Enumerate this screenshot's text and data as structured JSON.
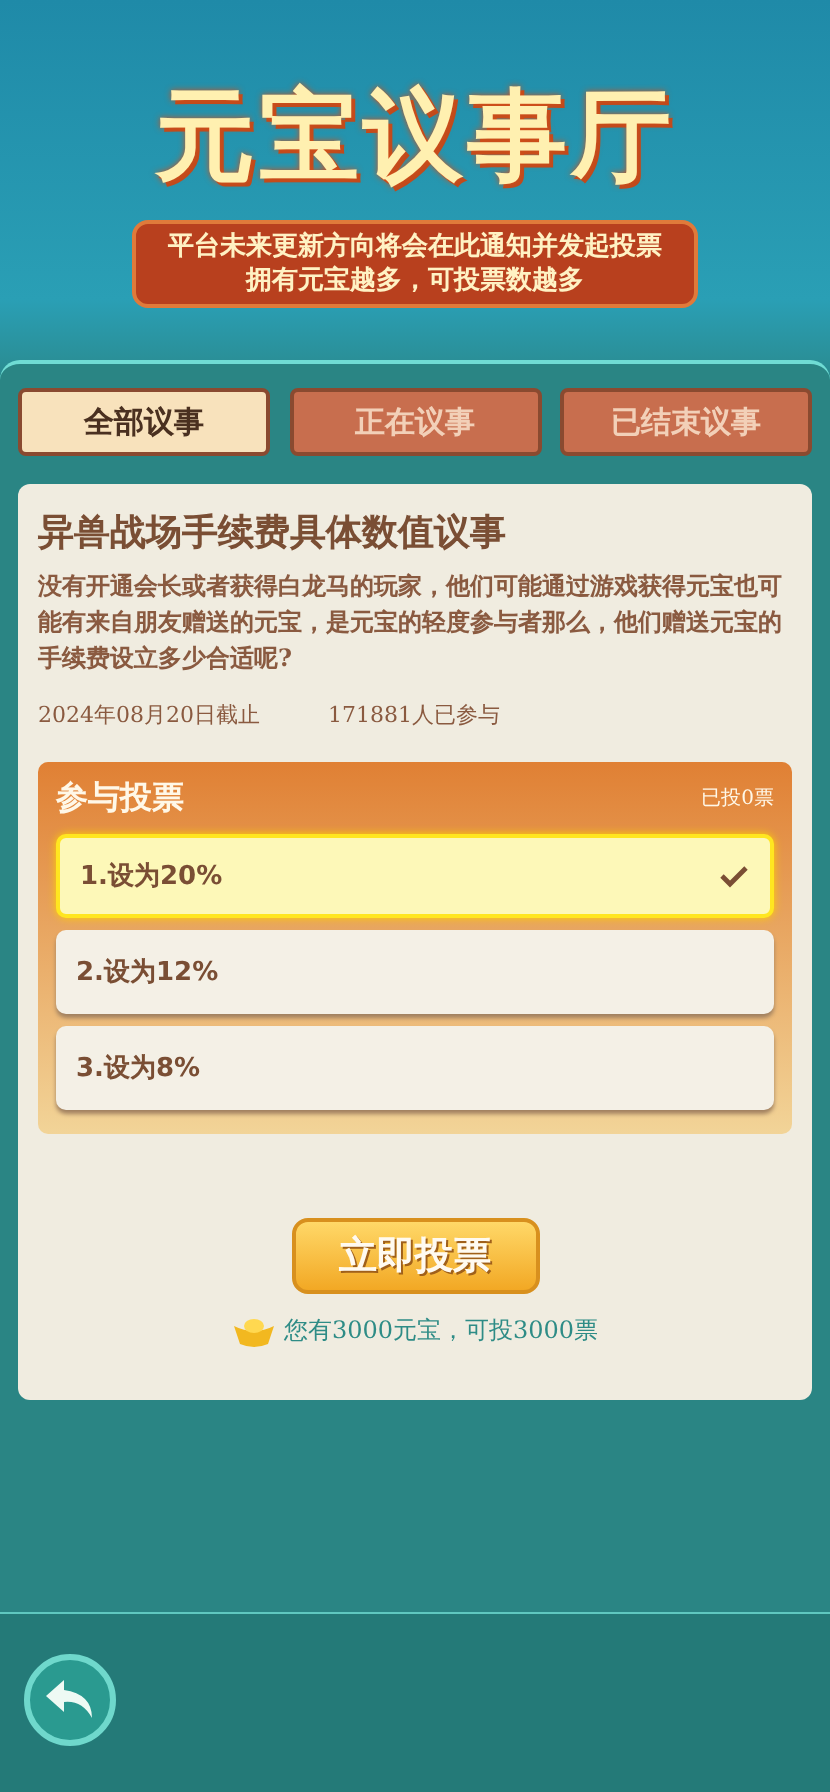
{
  "header": {
    "title": "元宝议事厅",
    "notice": [
      "平台未来更新方向将会在此通知并发起投票",
      "拥有元宝越多，可投票数越多"
    ]
  },
  "tabs": [
    {
      "label": "全部议事",
      "selected": true
    },
    {
      "label": "正在议事",
      "selected": false
    },
    {
      "label": "已结束议事",
      "selected": false
    }
  ],
  "proposal": {
    "title": "异兽战场手续费具体数值议事",
    "description": "没有开通会长或者获得白龙马的玩家，他们可能通过游戏获得元宝也可能有来自朋友赠送的元宝，是元宝的轻度参与者那么，他们赠送元宝的手续费设立多少合适呢?",
    "deadline": "2024年08月20日截止",
    "participants": "171881人已参与"
  },
  "vote": {
    "heading": "参与投票",
    "cast": "已投0票",
    "options": [
      {
        "label": "1.设为20%",
        "selected": true
      },
      {
        "label": "2.设为12%",
        "selected": false
      },
      {
        "label": "3.设为8%",
        "selected": false
      }
    ],
    "button": "立即投票",
    "balance": "您有3000元宝，可投3000票"
  }
}
